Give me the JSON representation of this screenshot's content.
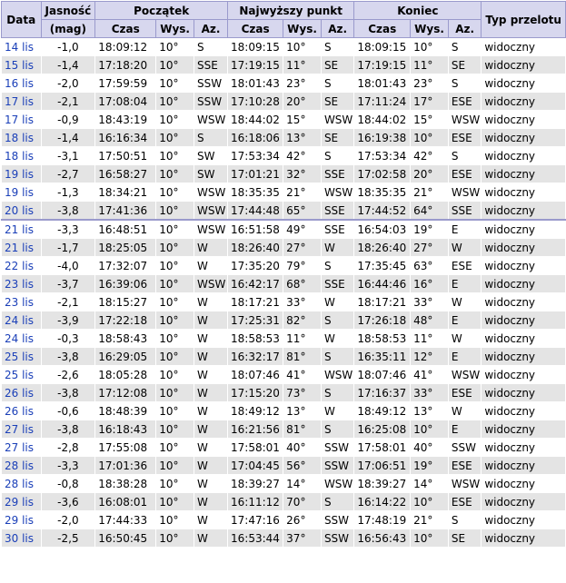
{
  "headers": {
    "date": "Data",
    "magnitude": "Jasność",
    "magnitude_unit": "(mag)",
    "start": "Początek",
    "highest": "Najwyższy punkt",
    "end": "Koniec",
    "pass_type": "Typ przelotu",
    "time": "Czas",
    "alt": "Wys.",
    "az": "Az."
  },
  "rows": [
    {
      "date": "14 lis",
      "mag": "-1,0",
      "s_time": "18:09:12",
      "s_alt": "10°",
      "s_az": "S",
      "h_time": "18:09:15",
      "h_alt": "10°",
      "h_az": "S",
      "e_time": "18:09:15",
      "e_alt": "10°",
      "e_az": "S",
      "type": "widoczny"
    },
    {
      "date": "15 lis",
      "mag": "-1,4",
      "s_time": "17:18:20",
      "s_alt": "10°",
      "s_az": "SSE",
      "h_time": "17:19:15",
      "h_alt": "11°",
      "h_az": "SE",
      "e_time": "17:19:15",
      "e_alt": "11°",
      "e_az": "SE",
      "type": "widoczny"
    },
    {
      "date": "16 lis",
      "mag": "-2,0",
      "s_time": "17:59:59",
      "s_alt": "10°",
      "s_az": "SSW",
      "h_time": "18:01:43",
      "h_alt": "23°",
      "h_az": "S",
      "e_time": "18:01:43",
      "e_alt": "23°",
      "e_az": "S",
      "type": "widoczny"
    },
    {
      "date": "17 lis",
      "mag": "-2,1",
      "s_time": "17:08:04",
      "s_alt": "10°",
      "s_az": "SSW",
      "h_time": "17:10:28",
      "h_alt": "20°",
      "h_az": "SE",
      "e_time": "17:11:24",
      "e_alt": "17°",
      "e_az": "ESE",
      "type": "widoczny"
    },
    {
      "date": "17 lis",
      "mag": "-0,9",
      "s_time": "18:43:19",
      "s_alt": "10°",
      "s_az": "WSW",
      "h_time": "18:44:02",
      "h_alt": "15°",
      "h_az": "WSW",
      "e_time": "18:44:02",
      "e_alt": "15°",
      "e_az": "WSW",
      "type": "widoczny"
    },
    {
      "date": "18 lis",
      "mag": "-1,4",
      "s_time": "16:16:34",
      "s_alt": "10°",
      "s_az": "S",
      "h_time": "16:18:06",
      "h_alt": "13°",
      "h_az": "SE",
      "e_time": "16:19:38",
      "e_alt": "10°",
      "e_az": "ESE",
      "type": "widoczny"
    },
    {
      "date": "18 lis",
      "mag": "-3,1",
      "s_time": "17:50:51",
      "s_alt": "10°",
      "s_az": "SW",
      "h_time": "17:53:34",
      "h_alt": "42°",
      "h_az": "S",
      "e_time": "17:53:34",
      "e_alt": "42°",
      "e_az": "S",
      "type": "widoczny"
    },
    {
      "date": "19 lis",
      "mag": "-2,7",
      "s_time": "16:58:27",
      "s_alt": "10°",
      "s_az": "SW",
      "h_time": "17:01:21",
      "h_alt": "32°",
      "h_az": "SSE",
      "e_time": "17:02:58",
      "e_alt": "20°",
      "e_az": "ESE",
      "type": "widoczny"
    },
    {
      "date": "19 lis",
      "mag": "-1,3",
      "s_time": "18:34:21",
      "s_alt": "10°",
      "s_az": "WSW",
      "h_time": "18:35:35",
      "h_alt": "21°",
      "h_az": "WSW",
      "e_time": "18:35:35",
      "e_alt": "21°",
      "e_az": "WSW",
      "type": "widoczny"
    },
    {
      "date": "20 lis",
      "mag": "-3,8",
      "s_time": "17:41:36",
      "s_alt": "10°",
      "s_az": "WSW",
      "h_time": "17:44:48",
      "h_alt": "65°",
      "h_az": "SSE",
      "e_time": "17:44:52",
      "e_alt": "64°",
      "e_az": "SSE",
      "type": "widoczny"
    },
    {
      "date": "21 lis",
      "mag": "-3,3",
      "s_time": "16:48:51",
      "s_alt": "10°",
      "s_az": "WSW",
      "h_time": "16:51:58",
      "h_alt": "49°",
      "h_az": "SSE",
      "e_time": "16:54:03",
      "e_alt": "19°",
      "e_az": "E",
      "type": "widoczny",
      "group_start": true
    },
    {
      "date": "21 lis",
      "mag": "-1,7",
      "s_time": "18:25:05",
      "s_alt": "10°",
      "s_az": "W",
      "h_time": "18:26:40",
      "h_alt": "27°",
      "h_az": "W",
      "e_time": "18:26:40",
      "e_alt": "27°",
      "e_az": "W",
      "type": "widoczny"
    },
    {
      "date": "22 lis",
      "mag": "-4,0",
      "s_time": "17:32:07",
      "s_alt": "10°",
      "s_az": "W",
      "h_time": "17:35:20",
      "h_alt": "79°",
      "h_az": "S",
      "e_time": "17:35:45",
      "e_alt": "63°",
      "e_az": "ESE",
      "type": "widoczny"
    },
    {
      "date": "23 lis",
      "mag": "-3,7",
      "s_time": "16:39:06",
      "s_alt": "10°",
      "s_az": "WSW",
      "h_time": "16:42:17",
      "h_alt": "68°",
      "h_az": "SSE",
      "e_time": "16:44:46",
      "e_alt": "16°",
      "e_az": "E",
      "type": "widoczny"
    },
    {
      "date": "23 lis",
      "mag": "-2,1",
      "s_time": "18:15:27",
      "s_alt": "10°",
      "s_az": "W",
      "h_time": "18:17:21",
      "h_alt": "33°",
      "h_az": "W",
      "e_time": "18:17:21",
      "e_alt": "33°",
      "e_az": "W",
      "type": "widoczny"
    },
    {
      "date": "24 lis",
      "mag": "-3,9",
      "s_time": "17:22:18",
      "s_alt": "10°",
      "s_az": "W",
      "h_time": "17:25:31",
      "h_alt": "82°",
      "h_az": "S",
      "e_time": "17:26:18",
      "e_alt": "48°",
      "e_az": "E",
      "type": "widoczny"
    },
    {
      "date": "24 lis",
      "mag": "-0,3",
      "s_time": "18:58:43",
      "s_alt": "10°",
      "s_az": "W",
      "h_time": "18:58:53",
      "h_alt": "11°",
      "h_az": "W",
      "e_time": "18:58:53",
      "e_alt": "11°",
      "e_az": "W",
      "type": "widoczny"
    },
    {
      "date": "25 lis",
      "mag": "-3,8",
      "s_time": "16:29:05",
      "s_alt": "10°",
      "s_az": "W",
      "h_time": "16:32:17",
      "h_alt": "81°",
      "h_az": "S",
      "e_time": "16:35:11",
      "e_alt": "12°",
      "e_az": "E",
      "type": "widoczny"
    },
    {
      "date": "25 lis",
      "mag": "-2,6",
      "s_time": "18:05:28",
      "s_alt": "10°",
      "s_az": "W",
      "h_time": "18:07:46",
      "h_alt": "41°",
      "h_az": "WSW",
      "e_time": "18:07:46",
      "e_alt": "41°",
      "e_az": "WSW",
      "type": "widoczny"
    },
    {
      "date": "26 lis",
      "mag": "-3,8",
      "s_time": "17:12:08",
      "s_alt": "10°",
      "s_az": "W",
      "h_time": "17:15:20",
      "h_alt": "73°",
      "h_az": "S",
      "e_time": "17:16:37",
      "e_alt": "33°",
      "e_az": "ESE",
      "type": "widoczny"
    },
    {
      "date": "26 lis",
      "mag": "-0,6",
      "s_time": "18:48:39",
      "s_alt": "10°",
      "s_az": "W",
      "h_time": "18:49:12",
      "h_alt": "13°",
      "h_az": "W",
      "e_time": "18:49:12",
      "e_alt": "13°",
      "e_az": "W",
      "type": "widoczny"
    },
    {
      "date": "27 lis",
      "mag": "-3,8",
      "s_time": "16:18:43",
      "s_alt": "10°",
      "s_az": "W",
      "h_time": "16:21:56",
      "h_alt": "81°",
      "h_az": "S",
      "e_time": "16:25:08",
      "e_alt": "10°",
      "e_az": "E",
      "type": "widoczny"
    },
    {
      "date": "27 lis",
      "mag": "-2,8",
      "s_time": "17:55:08",
      "s_alt": "10°",
      "s_az": "W",
      "h_time": "17:58:01",
      "h_alt": "40°",
      "h_az": "SSW",
      "e_time": "17:58:01",
      "e_alt": "40°",
      "e_az": "SSW",
      "type": "widoczny"
    },
    {
      "date": "28 lis",
      "mag": "-3,3",
      "s_time": "17:01:36",
      "s_alt": "10°",
      "s_az": "W",
      "h_time": "17:04:45",
      "h_alt": "56°",
      "h_az": "SSW",
      "e_time": "17:06:51",
      "e_alt": "19°",
      "e_az": "ESE",
      "type": "widoczny"
    },
    {
      "date": "28 lis",
      "mag": "-0,8",
      "s_time": "18:38:28",
      "s_alt": "10°",
      "s_az": "W",
      "h_time": "18:39:27",
      "h_alt": "14°",
      "h_az": "WSW",
      "e_time": "18:39:27",
      "e_alt": "14°",
      "e_az": "WSW",
      "type": "widoczny"
    },
    {
      "date": "29 lis",
      "mag": "-3,6",
      "s_time": "16:08:01",
      "s_alt": "10°",
      "s_az": "W",
      "h_time": "16:11:12",
      "h_alt": "70°",
      "h_az": "S",
      "e_time": "16:14:22",
      "e_alt": "10°",
      "e_az": "ESE",
      "type": "widoczny"
    },
    {
      "date": "29 lis",
      "mag": "-2,0",
      "s_time": "17:44:33",
      "s_alt": "10°",
      "s_az": "W",
      "h_time": "17:47:16",
      "h_alt": "26°",
      "h_az": "SSW",
      "e_time": "17:48:19",
      "e_alt": "21°",
      "e_az": "S",
      "type": "widoczny"
    },
    {
      "date": "30 lis",
      "mag": "-2,5",
      "s_time": "16:50:45",
      "s_alt": "10°",
      "s_az": "W",
      "h_time": "16:53:44",
      "h_alt": "37°",
      "h_az": "SSW",
      "e_time": "16:56:43",
      "e_alt": "10°",
      "e_az": "SE",
      "type": "widoczny"
    }
  ]
}
